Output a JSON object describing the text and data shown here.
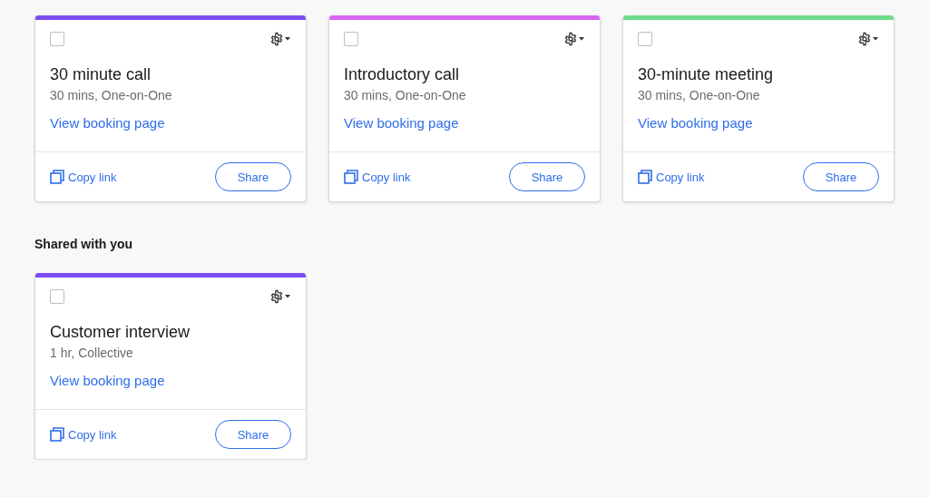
{
  "sections": [
    {
      "cards": [
        {
          "color": "#7b4cf0",
          "checked": false,
          "title": "30 minute call",
          "details": "30 mins, One-on-One",
          "link": "View booking page",
          "copy": "Copy link",
          "share": "Share"
        },
        {
          "color": "#d666f2",
          "checked": false,
          "title": "Introductory call",
          "details": "30 mins, One-on-One",
          "link": "View booking page",
          "copy": "Copy link",
          "share": "Share"
        },
        {
          "color": "#6fdc8c",
          "checked": false,
          "title": "30-minute meeting",
          "details": "30 mins, One-on-One",
          "link": "View booking page",
          "copy": "Copy link",
          "share": "Share"
        }
      ]
    },
    {
      "heading": "Shared with you",
      "cards": [
        {
          "color": "#7b4cf0",
          "checked": false,
          "title": "Customer interview",
          "details": "1 hr, Collective",
          "link": "View booking page",
          "copy": "Copy link",
          "share": "Share"
        }
      ]
    }
  ]
}
